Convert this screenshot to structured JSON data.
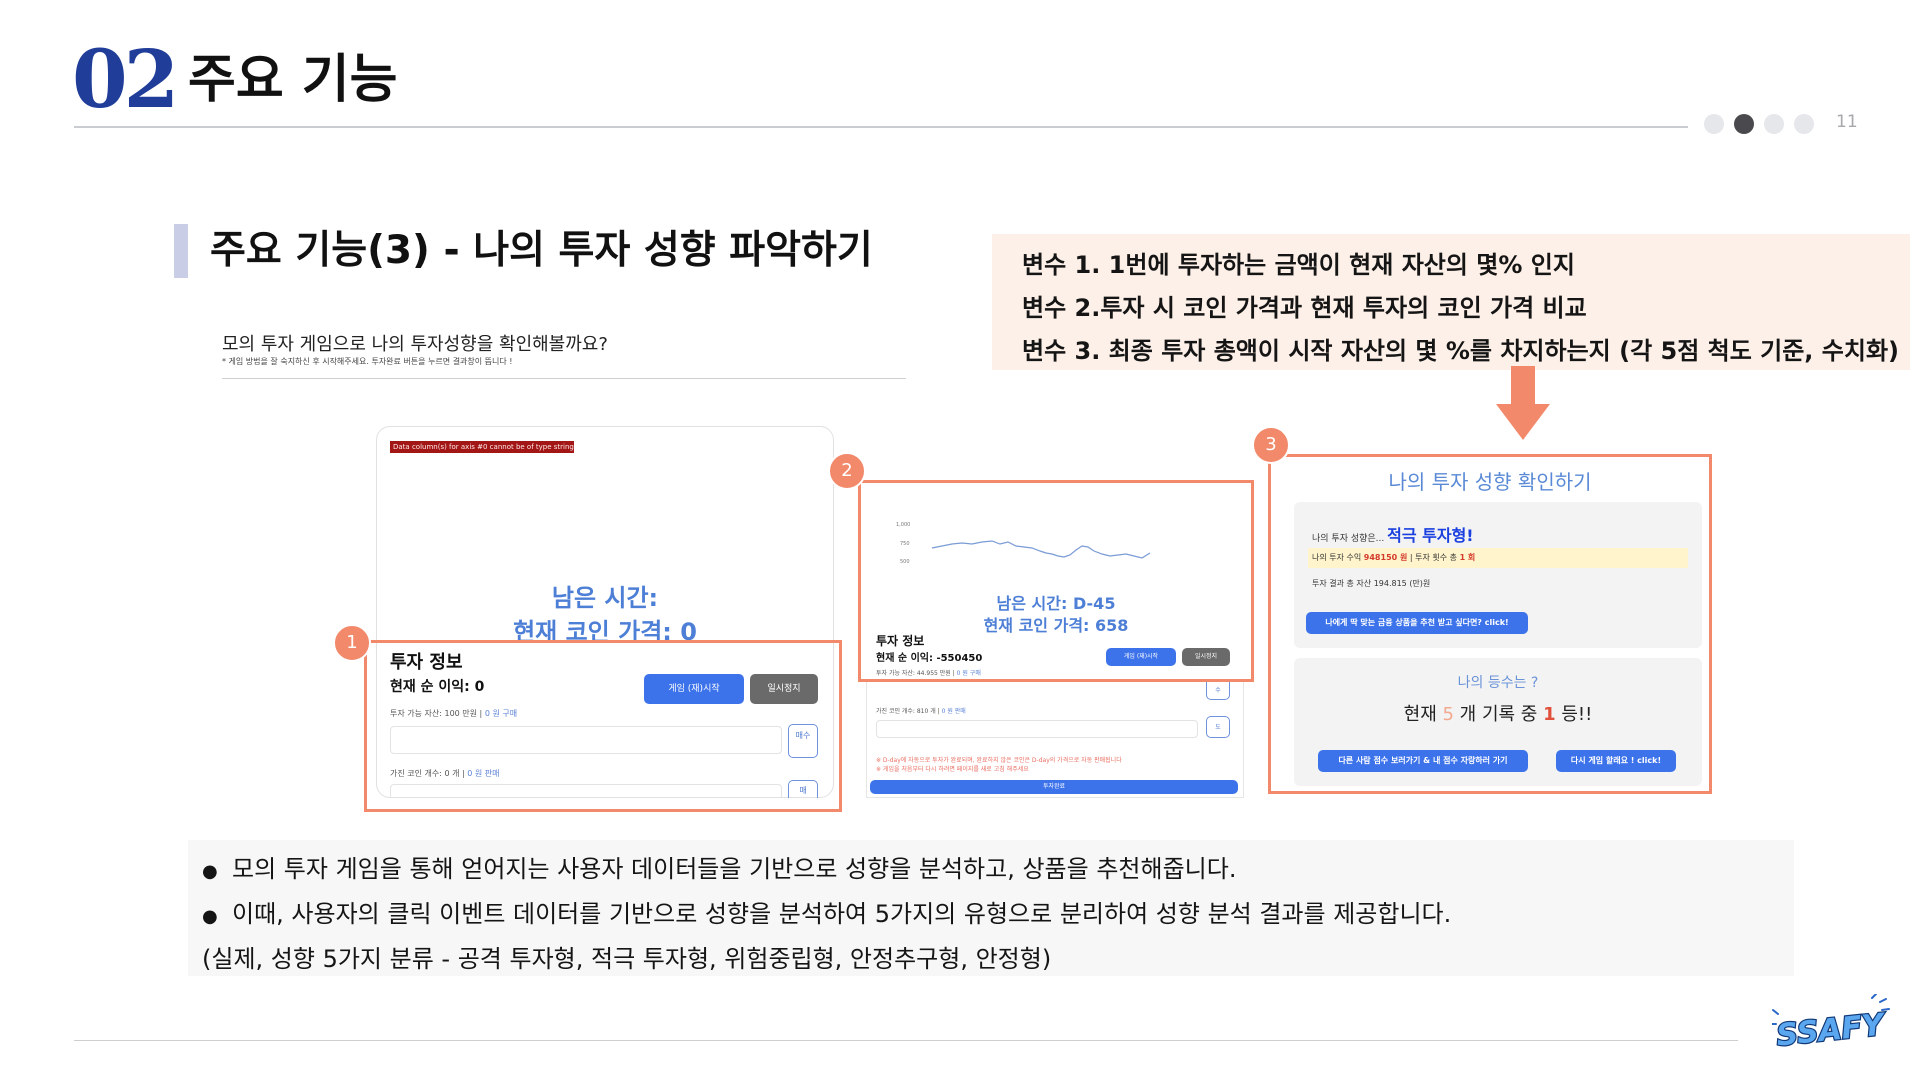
{
  "header": {
    "section_number": "02",
    "section_title": "주요 기능",
    "page_number": "11",
    "indicator_total": 4,
    "indicator_active": 2
  },
  "subsection": {
    "title": "주요 기능(3) - 나의 투자 성향 파악하기"
  },
  "variables": [
    "변수 1. 1번에 투자하는 금액이 현재 자산의 몇% 인지",
    "변수 2.투자 시 코인 가격과 현재 투자의 코인 가격 비교",
    "변수 3. 최종 투자 총액이 시작 자산의 몇 %를 차지하는지 (각 5점 척도 기준, 수치화)"
  ],
  "game_intro": {
    "title": "모의 투자 게임으로 나의 투자성향을 확인해볼까요?",
    "note": "* 게임 방법을 잘 숙지하신 후 시작해주세요. 투자완료 버튼을 누르면 결과창이 뜹니다 !"
  },
  "screenshot1": {
    "badge": "1",
    "error_tag": "Data column(s) for axis #0 cannot be of type string",
    "remaining_time": "남은 시간:",
    "coin_price": "현재 코인 가격: 0",
    "info_title": "투자 정보",
    "net_profit": "현재 순 이익: 0",
    "start_button": "게임 (재)시작",
    "pause_button": "일시정지",
    "available_assets": "투자 가능 자산: 100 만원 | ",
    "buy_link": "0 원 구매",
    "buy_button": "매수",
    "coins_held": "가진 코인 개수: 0 개 | ",
    "sell_link": "0 원 판매",
    "sell_button": "매"
  },
  "screenshot2": {
    "badge": "2",
    "y_ticks": [
      "1,000",
      "750",
      "500"
    ],
    "remaining_time": "남은 시간: D-45",
    "coin_price": "현재 코인 가격: 658",
    "info_title": "투자 정보",
    "net_profit": "현재 순 이익: -550450",
    "start_button": "게임 (재)시작",
    "pause_button": "일시정지",
    "available_assets": "투자 가능 자산: 44.955 만원 | ",
    "buy_link": "0 원 구매",
    "buy_button": "수",
    "coins_held": "가진 코인 개수: 810 개 | ",
    "sell_link": "0 원 판매",
    "sell_button": "도",
    "warning_1": "※ D-day에 자동으로 투자가 완료되며, 완료하지 않은 코인은 D-day의 가격으로 자동 판매됩니다",
    "warning_2": "※ 게임을 처음부터 다시 하려면 페이지를 새로 고침 해주세요",
    "end_button": "투자완료"
  },
  "screenshot3": {
    "badge": "3",
    "title": "나의 투자 성향 확인하기",
    "tendency_label": "나의 투자 성향은... ",
    "tendency_value": "적극 투자형!",
    "earnings_label": "나의 투자 수익 ",
    "earnings_value": "948150 원",
    "trades_label": " | 투자 횟수 총 ",
    "trades_value": "1 회",
    "final_assets": "투자 결과 총 자산 194.815 (만)원",
    "recommend_button": "나에게 딱 맞는 금융 상품을 추천 받고 싶다면? click!",
    "rank_question": "나의 등수는 ?",
    "rank_prefix": "현재 ",
    "rank_total": "5",
    "rank_middle": " 개 기록 중 ",
    "rank_value": "1",
    "rank_suffix": " 등!!",
    "other_scores_button": "다른 사람 점수 보러가기 & 내 점수 자랑하러 가기",
    "play_again_button": "다시 게임 할래요 ! click!"
  },
  "description": {
    "bullet_1": "모의 투자 게임을 통해 얻어지는 사용자 데이터들을 기반으로 성향을 분석하고, 상품을 추천해줍니다.",
    "bullet_2": "이때, 사용자의 클릭 이벤트 데이터를 기반으로 성향을 분석하여 5가지의 유형으로 분리하여 성향 분석 결과를 제공합니다.",
    "note": "(실제, 성향 5가지 분류 - 공격 투자형, 적극 투자형, 위험중립형, 안정추구형, 안정형)"
  },
  "footer": {
    "logo_text": "SSAFY"
  },
  "colors": {
    "accent_navy": "#1f3d99",
    "highlight_orange": "#f2896a",
    "link_blue": "#4d7fd6",
    "button_blue": "#3d73ea"
  }
}
